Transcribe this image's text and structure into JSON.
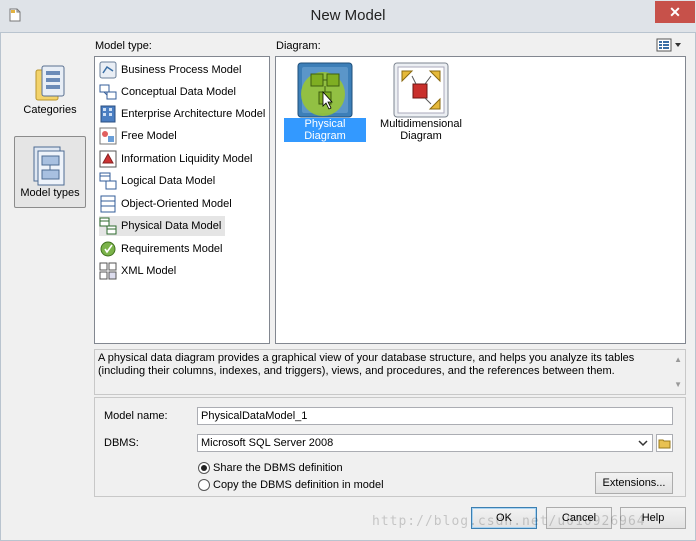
{
  "window": {
    "title": "New Model",
    "close_glyph": "✕"
  },
  "nav": [
    {
      "label": "Categories",
      "icon": "categories-icon"
    },
    {
      "label": "Model types",
      "icon": "model-types-icon",
      "selected": true
    }
  ],
  "model_type": {
    "label": "Model type:",
    "items": [
      {
        "label": "Business Process Model",
        "icon": "business-process-model-icon"
      },
      {
        "label": "Conceptual Data Model",
        "icon": "conceptual-data-model-icon"
      },
      {
        "label": "Enterprise Architecture Model",
        "icon": "enterprise-architecture-model-icon"
      },
      {
        "label": "Free Model",
        "icon": "free-model-icon"
      },
      {
        "label": "Information Liquidity Model",
        "icon": "information-liquidity-model-icon"
      },
      {
        "label": "Logical Data Model",
        "icon": "logical-data-model-icon"
      },
      {
        "label": "Object-Oriented Model",
        "icon": "object-oriented-model-icon"
      },
      {
        "label": "Physical Data Model",
        "icon": "physical-data-model-icon",
        "selected": true
      },
      {
        "label": "Requirements Model",
        "icon": "requirements-model-icon"
      },
      {
        "label": "XML Model",
        "icon": "xml-model-icon"
      }
    ]
  },
  "diagram": {
    "label": "Diagram:",
    "view_icon": "list-view-icon",
    "items": [
      {
        "label": "Physical Diagram",
        "icon": "physical-diagram-icon",
        "selected": true
      },
      {
        "label": "Multidimensional\nDiagram",
        "label_line1": "Multidimensional",
        "label_line2": "Diagram",
        "icon": "multidimensional-diagram-icon"
      }
    ]
  },
  "description": "A physical data diagram provides a graphical view of your database structure, and helps you analyze its tables (including their columns, indexes, and triggers), views, and procedures, and the references between them.",
  "form": {
    "model_name_label": "Model name:",
    "model_name_value": "PhysicalDataModel_1",
    "dbms_label": "DBMS:",
    "dbms_value": "Microsoft SQL Server 2008",
    "radio_share": "Share the DBMS definition",
    "radio_copy": "Copy the DBMS definition in model",
    "share_selected": true,
    "extensions_label": "Extensions..."
  },
  "buttons": {
    "ok": "OK",
    "cancel": "Cancel",
    "help": "Help"
  },
  "watermark": "http://blog.csdn.net/u010926964",
  "colors": {
    "selection": "#3399ff",
    "close_button": "#c7514a",
    "dialog_bg": "#f0f0f0"
  }
}
